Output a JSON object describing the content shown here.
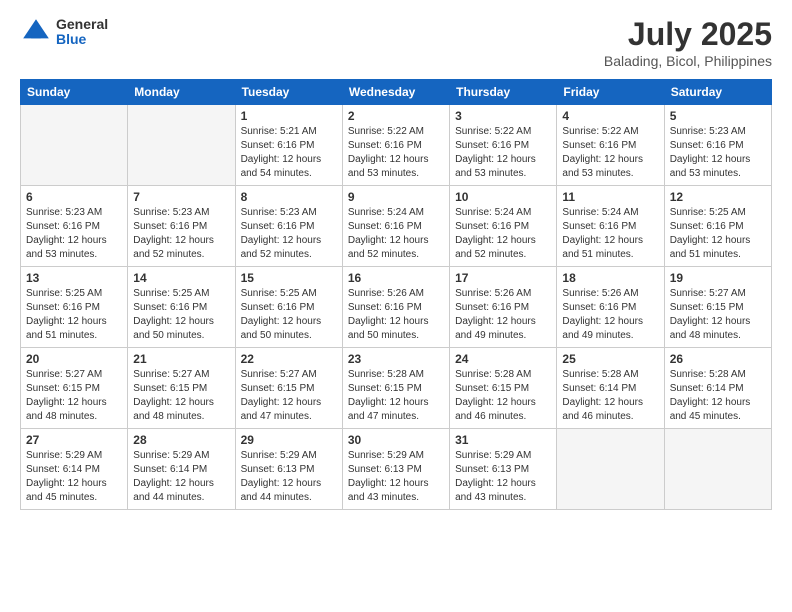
{
  "header": {
    "logo_general": "General",
    "logo_blue": "Blue",
    "month_year": "July 2025",
    "location": "Balading, Bicol, Philippines"
  },
  "weekdays": [
    "Sunday",
    "Monday",
    "Tuesday",
    "Wednesday",
    "Thursday",
    "Friday",
    "Saturday"
  ],
  "weeks": [
    [
      {
        "day": "",
        "info": ""
      },
      {
        "day": "",
        "info": ""
      },
      {
        "day": "1",
        "info": "Sunrise: 5:21 AM\nSunset: 6:16 PM\nDaylight: 12 hours and 54 minutes."
      },
      {
        "day": "2",
        "info": "Sunrise: 5:22 AM\nSunset: 6:16 PM\nDaylight: 12 hours and 53 minutes."
      },
      {
        "day": "3",
        "info": "Sunrise: 5:22 AM\nSunset: 6:16 PM\nDaylight: 12 hours and 53 minutes."
      },
      {
        "day": "4",
        "info": "Sunrise: 5:22 AM\nSunset: 6:16 PM\nDaylight: 12 hours and 53 minutes."
      },
      {
        "day": "5",
        "info": "Sunrise: 5:23 AM\nSunset: 6:16 PM\nDaylight: 12 hours and 53 minutes."
      }
    ],
    [
      {
        "day": "6",
        "info": "Sunrise: 5:23 AM\nSunset: 6:16 PM\nDaylight: 12 hours and 53 minutes."
      },
      {
        "day": "7",
        "info": "Sunrise: 5:23 AM\nSunset: 6:16 PM\nDaylight: 12 hours and 52 minutes."
      },
      {
        "day": "8",
        "info": "Sunrise: 5:23 AM\nSunset: 6:16 PM\nDaylight: 12 hours and 52 minutes."
      },
      {
        "day": "9",
        "info": "Sunrise: 5:24 AM\nSunset: 6:16 PM\nDaylight: 12 hours and 52 minutes."
      },
      {
        "day": "10",
        "info": "Sunrise: 5:24 AM\nSunset: 6:16 PM\nDaylight: 12 hours and 52 minutes."
      },
      {
        "day": "11",
        "info": "Sunrise: 5:24 AM\nSunset: 6:16 PM\nDaylight: 12 hours and 51 minutes."
      },
      {
        "day": "12",
        "info": "Sunrise: 5:25 AM\nSunset: 6:16 PM\nDaylight: 12 hours and 51 minutes."
      }
    ],
    [
      {
        "day": "13",
        "info": "Sunrise: 5:25 AM\nSunset: 6:16 PM\nDaylight: 12 hours and 51 minutes."
      },
      {
        "day": "14",
        "info": "Sunrise: 5:25 AM\nSunset: 6:16 PM\nDaylight: 12 hours and 50 minutes."
      },
      {
        "day": "15",
        "info": "Sunrise: 5:25 AM\nSunset: 6:16 PM\nDaylight: 12 hours and 50 minutes."
      },
      {
        "day": "16",
        "info": "Sunrise: 5:26 AM\nSunset: 6:16 PM\nDaylight: 12 hours and 50 minutes."
      },
      {
        "day": "17",
        "info": "Sunrise: 5:26 AM\nSunset: 6:16 PM\nDaylight: 12 hours and 49 minutes."
      },
      {
        "day": "18",
        "info": "Sunrise: 5:26 AM\nSunset: 6:16 PM\nDaylight: 12 hours and 49 minutes."
      },
      {
        "day": "19",
        "info": "Sunrise: 5:27 AM\nSunset: 6:15 PM\nDaylight: 12 hours and 48 minutes."
      }
    ],
    [
      {
        "day": "20",
        "info": "Sunrise: 5:27 AM\nSunset: 6:15 PM\nDaylight: 12 hours and 48 minutes."
      },
      {
        "day": "21",
        "info": "Sunrise: 5:27 AM\nSunset: 6:15 PM\nDaylight: 12 hours and 48 minutes."
      },
      {
        "day": "22",
        "info": "Sunrise: 5:27 AM\nSunset: 6:15 PM\nDaylight: 12 hours and 47 minutes."
      },
      {
        "day": "23",
        "info": "Sunrise: 5:28 AM\nSunset: 6:15 PM\nDaylight: 12 hours and 47 minutes."
      },
      {
        "day": "24",
        "info": "Sunrise: 5:28 AM\nSunset: 6:15 PM\nDaylight: 12 hours and 46 minutes."
      },
      {
        "day": "25",
        "info": "Sunrise: 5:28 AM\nSunset: 6:14 PM\nDaylight: 12 hours and 46 minutes."
      },
      {
        "day": "26",
        "info": "Sunrise: 5:28 AM\nSunset: 6:14 PM\nDaylight: 12 hours and 45 minutes."
      }
    ],
    [
      {
        "day": "27",
        "info": "Sunrise: 5:29 AM\nSunset: 6:14 PM\nDaylight: 12 hours and 45 minutes."
      },
      {
        "day": "28",
        "info": "Sunrise: 5:29 AM\nSunset: 6:14 PM\nDaylight: 12 hours and 44 minutes."
      },
      {
        "day": "29",
        "info": "Sunrise: 5:29 AM\nSunset: 6:13 PM\nDaylight: 12 hours and 44 minutes."
      },
      {
        "day": "30",
        "info": "Sunrise: 5:29 AM\nSunset: 6:13 PM\nDaylight: 12 hours and 43 minutes."
      },
      {
        "day": "31",
        "info": "Sunrise: 5:29 AM\nSunset: 6:13 PM\nDaylight: 12 hours and 43 minutes."
      },
      {
        "day": "",
        "info": ""
      },
      {
        "day": "",
        "info": ""
      }
    ]
  ]
}
